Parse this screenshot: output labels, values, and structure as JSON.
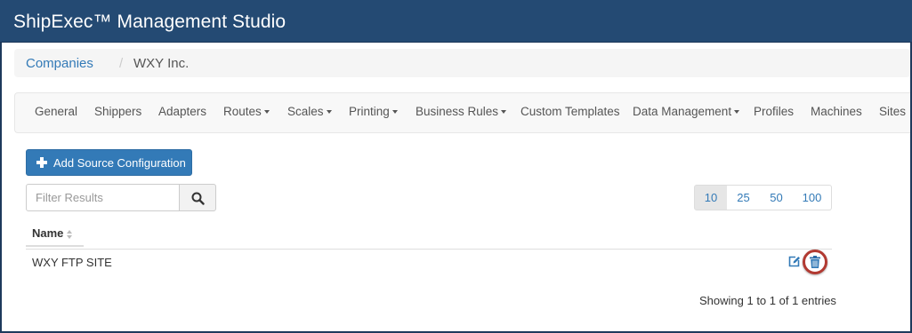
{
  "app": {
    "title": "ShipExec™ Management Studio"
  },
  "breadcrumb": {
    "parent": "Companies",
    "separator": "/",
    "current": "WXY Inc."
  },
  "nav": {
    "items": [
      {
        "label": "General",
        "dropdown": false
      },
      {
        "label": "Shippers",
        "dropdown": false
      },
      {
        "label": "Adapters",
        "dropdown": false
      },
      {
        "label": "Routes",
        "dropdown": true
      },
      {
        "label": "Scales",
        "dropdown": true
      },
      {
        "label": "Printing",
        "dropdown": true
      },
      {
        "label": "Business Rules",
        "dropdown": true
      },
      {
        "label": "Custom Templates",
        "dropdown": false
      },
      {
        "label": "Data Management",
        "dropdown": true
      },
      {
        "label": "Profiles",
        "dropdown": false
      },
      {
        "label": "Machines",
        "dropdown": false
      },
      {
        "label": "Sites",
        "dropdown": false
      }
    ]
  },
  "toolbar": {
    "add_label": "Add Source Configuration",
    "add_icon": "plus-icon"
  },
  "filter": {
    "placeholder": "Filter Results",
    "value": "",
    "search_icon": "search-icon"
  },
  "pagination": {
    "sizes": [
      "10",
      "25",
      "50",
      "100"
    ],
    "selected": "10"
  },
  "table": {
    "columns": [
      {
        "label": "Name",
        "sortable": true
      }
    ],
    "rows": [
      {
        "name": "WXY FTP SITE",
        "actions": [
          "edit-icon",
          "trash-icon"
        ]
      }
    ]
  },
  "footer": {
    "info": "Showing 1 to 1 of 1 entries"
  },
  "colors": {
    "header_bg": "#244a73",
    "primary": "#337ab7",
    "highlight_ring": "#b23a32"
  }
}
